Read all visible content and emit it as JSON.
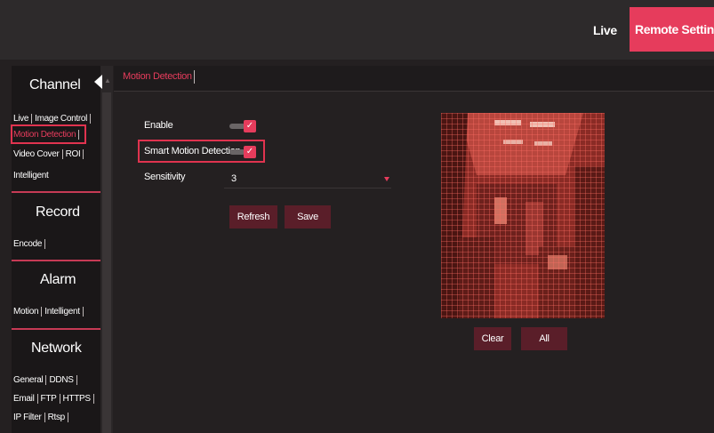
{
  "header": {
    "live_label": "Live",
    "remote_label": "Remote Setting"
  },
  "sidebar": {
    "channel": {
      "title": "Channel",
      "rows": [
        [
          "Live",
          "Image Control"
        ],
        [
          "Motion Detection"
        ],
        [
          "Video Cover",
          "ROI"
        ],
        [
          "Intelligent"
        ]
      ]
    },
    "record": {
      "title": "Record",
      "rows": [
        [
          "Encode"
        ]
      ]
    },
    "alarm": {
      "title": "Alarm",
      "rows": [
        [
          "Motion",
          "Intelligent"
        ]
      ]
    },
    "network": {
      "title": "Network",
      "rows": [
        [
          "General",
          "DDNS"
        ],
        [
          "Email",
          "FTP",
          "HTTPS"
        ],
        [
          "IP Filter",
          "Rtsp"
        ]
      ]
    }
  },
  "tabs": {
    "active": "Motion Detection"
  },
  "form": {
    "enable_label": "Enable",
    "enable_checked": true,
    "smart_label": "Smart Motion Detection",
    "smart_checked": true,
    "sensitivity_label": "Sensitivity",
    "sensitivity_value": "3",
    "refresh_label": "Refresh",
    "save_label": "Save"
  },
  "preview": {
    "clear_label": "Clear",
    "all_label": "All"
  },
  "icons": {
    "check": "check-icon",
    "collapse": "collapse-left-icon",
    "dropdown": "dropdown-arrow-icon",
    "scroll_up": "scroll-up-icon"
  },
  "colors": {
    "accent": "#e63c5c",
    "button": "#5a1e29",
    "background": "#242021"
  }
}
